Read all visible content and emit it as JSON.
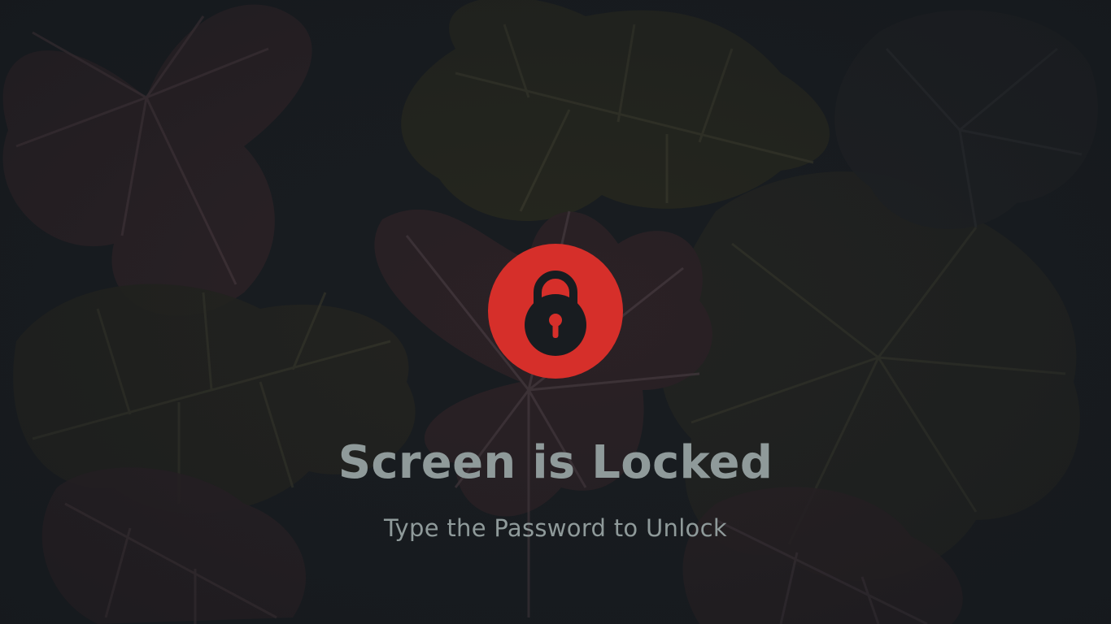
{
  "lock_screen": {
    "title": "Screen is Locked",
    "subtitle": "Type the Password to Unlock",
    "icon": "padlock-icon"
  },
  "colors": {
    "background": "#181c20",
    "accent": "#d62f2a",
    "text": "#8f9a9a",
    "leaf_maroon": "#33262a",
    "leaf_olive": "#2b2b20"
  }
}
